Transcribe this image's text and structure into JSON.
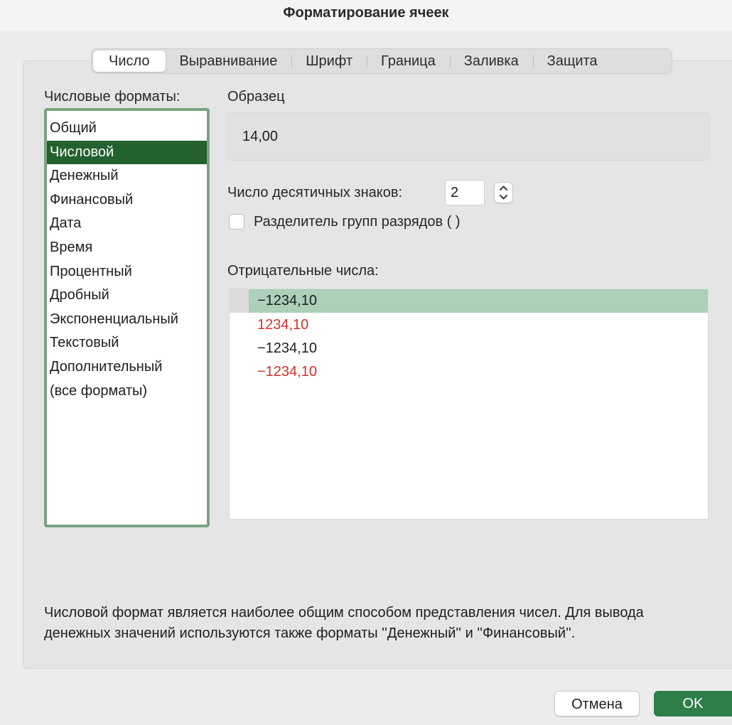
{
  "window": {
    "title": "Форматирование ячеек"
  },
  "tabs": [
    {
      "label": "Число",
      "active": true
    },
    {
      "label": "Выравнивание",
      "active": false
    },
    {
      "label": "Шрифт",
      "active": false
    },
    {
      "label": "Граница",
      "active": false
    },
    {
      "label": "Заливка",
      "active": false
    },
    {
      "label": "Защита",
      "active": false
    }
  ],
  "formats": {
    "label": "Числовые форматы:",
    "items": [
      "Общий",
      "Числовой",
      "Денежный",
      "Финансовый",
      "Дата",
      "Время",
      "Процентный",
      "Дробный",
      "Экспоненциальный",
      "Текстовый",
      "Дополнительный",
      "(все форматы)"
    ],
    "selected": "Числовой"
  },
  "sample": {
    "label": "Образец",
    "value": "14,00"
  },
  "decimals": {
    "label": "Число десятичных знаков:",
    "value": "2"
  },
  "separator": {
    "label": "Разделитель групп разрядов ( )",
    "checked": false
  },
  "negative": {
    "label": "Отрицательные числа:",
    "items": [
      {
        "text": "−1234,10",
        "color": "#1e1e1e",
        "selected": true
      },
      {
        "text": "1234,10",
        "color": "#d7302a",
        "selected": false
      },
      {
        "text": "−1234,10",
        "color": "#1e1e1e",
        "selected": false
      },
      {
        "text": "−1234,10",
        "color": "#d7302a",
        "selected": false
      }
    ]
  },
  "description": "Числовой формат является наиболее общим способом представления чисел. Для вывода денежных значений используются также форматы ''Денежный'' и ''Финансовый''.",
  "buttons": {
    "cancel": "Отмена",
    "ok": "OK"
  },
  "colors": {
    "accent_green": "#23612f",
    "list_border_green": "#7aa381",
    "negative_selected_bg": "#acd0b8",
    "ok_button_bg": "#2e7e4a",
    "negative_red": "#d7302a"
  }
}
